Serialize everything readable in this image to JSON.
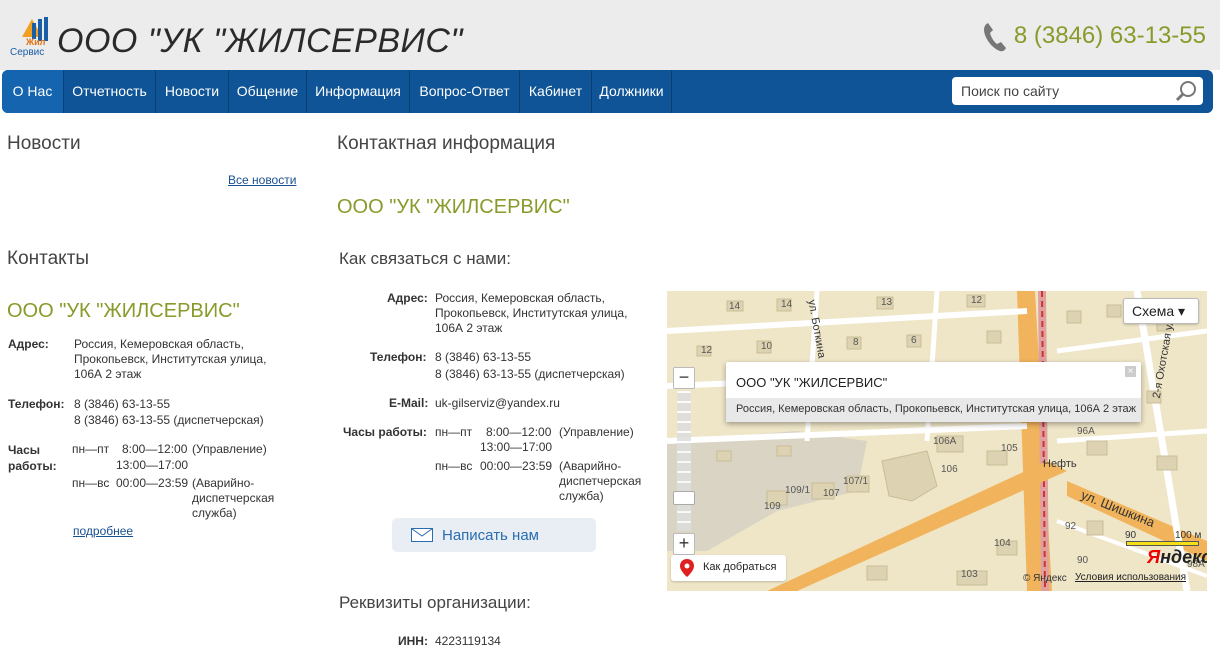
{
  "header": {
    "logo_text": "ООО \"УК \"ЖИЛСЕРВИС\"",
    "phone": "8 (3846) 63-13-55"
  },
  "nav": {
    "items": [
      "О Нас",
      "Отчетность",
      "Новости",
      "Общение",
      "Информация",
      "Вопрос-Ответ",
      "Кабинет",
      "Должники"
    ],
    "search_placeholder": "Поиск по сайту"
  },
  "left": {
    "news_title": "Новости",
    "all_news": "Все новости",
    "contacts_title": "Контакты",
    "company": "ООО \"УК \"ЖИЛСЕРВИС\"",
    "address_label": "Адрес:",
    "address": "Россия, Кемеровская область, Прокопьевск, Институтская улица, 106А 2 этаж",
    "phone_label": "Телефон:",
    "phone1": "8 (3846) 63-13-55",
    "phone2": "8 (3846) 63-13-55 (диспетчерская)",
    "hours_label": "Часы работы:",
    "hours1_days": "пн—пт",
    "hours1_time": "8:00—12:00",
    "hours1_note": "(Управление)",
    "hours1_time2": "13:00—17:00",
    "hours2_days": "пн—вс",
    "hours2_time": "00:00—23:59",
    "hours2_note": "(Аварийно-диспетчерская служба)",
    "more": "подробнее"
  },
  "main": {
    "contact_title": "Контактная информация",
    "company": "ООО \"УК \"ЖИЛСЕРВИС\"",
    "how_title": "Как связаться с нами:",
    "address_label": "Адрес:",
    "address": "Россия, Кемеровская область, Прокопьевск, Институтская улица, 106А 2 этаж",
    "phone_label": "Телефон:",
    "phone1": "8 (3846) 63-13-55",
    "phone2": "8 (3846) 63-13-55 (диспетчерская)",
    "email_label": "E-Mail:",
    "email": "uk-gilserviz@yandex.ru",
    "hours_label": "Часы работы:",
    "hours1_days": "пн—пт",
    "hours1_time": "8:00—12:00",
    "hours1_note": "(Управление)",
    "hours1_time2": "13:00—17:00",
    "hours2_days": "пн—вс",
    "hours2_time": "00:00—23:59",
    "hours2_note": "(Аварийно-диспетчерская служба)",
    "write_button": "Написать нам",
    "requisites_title": "Реквизиты организации:",
    "inn_label": "ИНН:",
    "inn": "4223119134"
  },
  "map": {
    "scheme_button": "Схема ▾",
    "balloon_title": "ООО \"УК \"ЖИЛСЕРВИС\"",
    "balloon_address": "Россия, Кемеровская область, Прокопьевск, Институтская улица, 106А 2 этаж",
    "route_button": "Как добраться",
    "copyright": "© Яндекс",
    "terms": "Условия использования",
    "scale_left": "90",
    "scale_right": "100 м",
    "yandex_y": "Я",
    "yandex_rest": "ндекс",
    "street_shishkina": "ул. Шишкина",
    "street_okhotskaya": "2-я Охотская ул.",
    "street_botkina": "ул. Боткина",
    "neft": "Нефть",
    "house_labels": [
      "14",
      "14",
      "13",
      "12",
      "12",
      "10",
      "8",
      "6",
      "106А",
      "106",
      "105",
      "109/1",
      "107",
      "107/1",
      "109",
      "104",
      "103",
      "96А",
      "92",
      "90",
      "98А"
    ]
  },
  "colors": {
    "nav_bg": "#0e5496",
    "accent_green": "#8a9a2a",
    "link": "#1a4f8f"
  }
}
